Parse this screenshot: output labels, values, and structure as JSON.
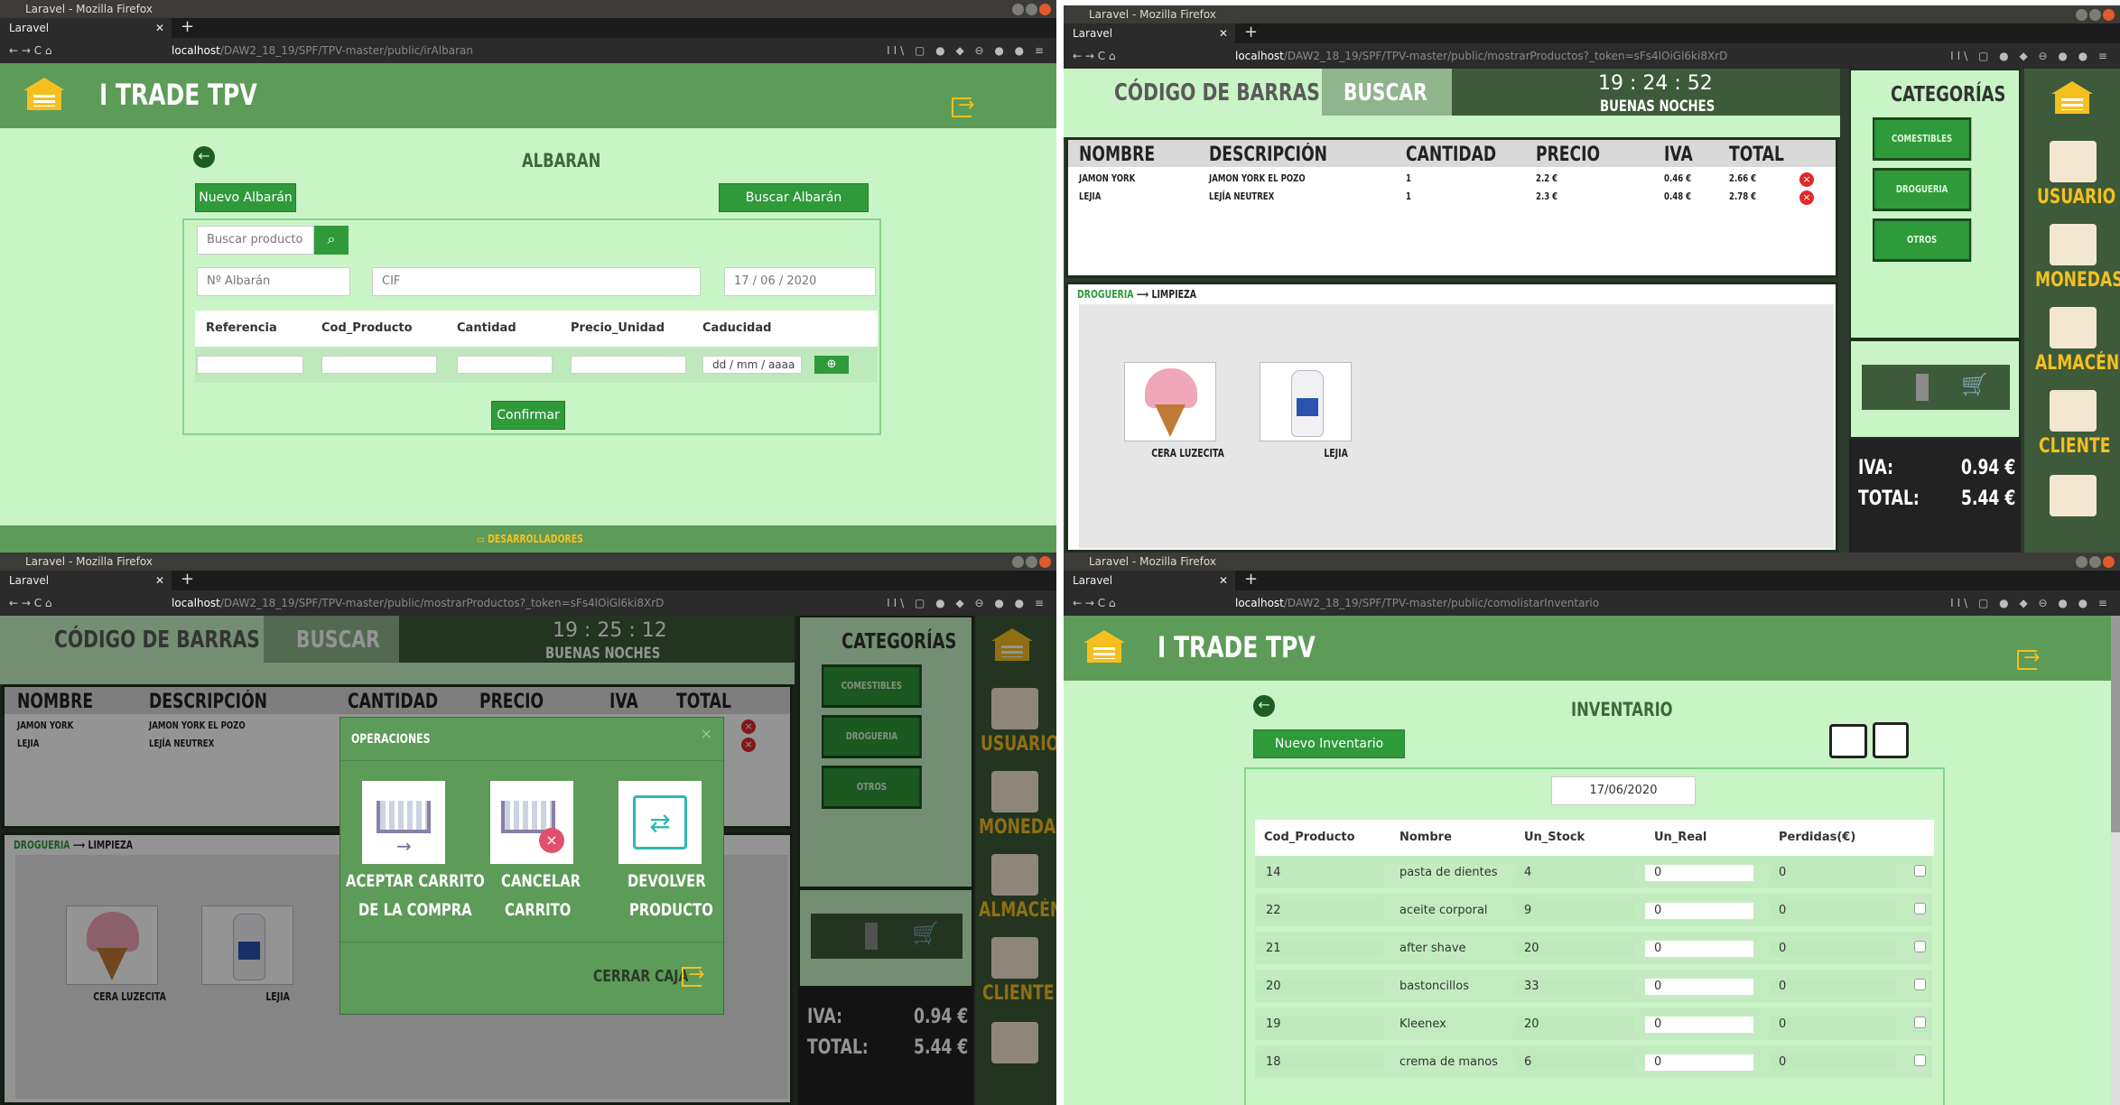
{
  "window": {
    "title": "Laravel - Mozilla Firefox",
    "tab": "Laravel",
    "close_tab": "✕",
    "new_tab": "+"
  },
  "nav_icons": "← → C ⌂",
  "right_icons": "⋯ ♡ ☆",
  "toolbar_icons": "II\\ ▢ ● ◆ ⊖ ● ● ≡",
  "urls": {
    "albaran_host": "localhost",
    "albaran_path": "/DAW2_18_19/SPF/TPV-master/public/irAlbaran",
    "productos_host": "localhost",
    "productos_path": "/DAW2_18_19/SPF/TPV-master/public/mostrarProductos?_token=sFs4lOiGl6ki8XrD",
    "productos2_path": "/DAW2_18_19/SPF/TPV-master/public/mostrarProductos?_token=sFs4lOiGl6ki8XrD",
    "inventario_host": "localhost",
    "inventario_path": "/DAW2_18_19/SPF/TPV-master/public/comolistarInventario"
  },
  "brand": "I TRADE TPV",
  "footer_link": "DESARROLLADORES",
  "albaran": {
    "title": "ALBARAN",
    "new_button": "Nuevo Albarán",
    "search_button": "Buscar Albarán",
    "search_placeholder": "Buscar producto",
    "num_placeholder": "Nº Albarán",
    "cif_placeholder": "CIF",
    "date": "17 / 06 / 2020",
    "columns": [
      "Referencia",
      "Cod_Producto",
      "Cantidad",
      "Precio_Unidad",
      "Caducidad"
    ],
    "date_placeholder": "dd / mm / aaaa",
    "confirm_button": "Confirmar"
  },
  "tpv": {
    "barcode_tab": "CÓDIGO DE BARRAS",
    "search_tab": "BUSCAR",
    "time": "19 : 24 : 52",
    "time2": "19 : 25 : 12",
    "greeting": "BUENAS NOCHES",
    "columns": [
      "NOMBRE",
      "DESCRIPCIÓN",
      "CANTIDAD",
      "PRECIO",
      "IVA",
      "TOTAL"
    ],
    "rows": [
      {
        "nombre": "JAMON YORK",
        "descripcion": "JAMON YORK EL POZO",
        "cantidad": "1",
        "precio": "2.2 €",
        "iva": "0.46 €",
        "total": "2.66 €"
      },
      {
        "nombre": "LEJIA",
        "descripcion": "LEJÍA NEUTREX",
        "cantidad": "1",
        "precio": "2.3 €",
        "iva": "0.48 €",
        "total": "2.78 €"
      }
    ],
    "breadcrumb_a": "DROGUERIA",
    "breadcrumb_b": "LIMPIEZA",
    "products": [
      "CERA LUZECITA",
      "LEJIA"
    ],
    "categories_title": "CATEGORÍAS",
    "categories": [
      "COMESTIBLES",
      "DROGUERIA",
      "OTROS"
    ],
    "iva_label": "IVA:",
    "iva_value": "0.94 €",
    "total_label": "TOTAL:",
    "total_value": "5.44 €",
    "sidebar": [
      "USUARIO",
      "MONEDAS",
      "ALMACÉN",
      "CLIENTE"
    ]
  },
  "modal": {
    "title": "OPERACIONES",
    "close": "×",
    "ops": [
      {
        "l1": "ACEPTAR CARRITO",
        "l2": "DE LA COMPRA"
      },
      {
        "l1": "CANCELAR",
        "l2": "CARRITO"
      },
      {
        "l1": "DEVOLVER",
        "l2": "PRODUCTO"
      }
    ],
    "close_cash": "CERRAR CAJA"
  },
  "inventario": {
    "title": "INVENTARIO",
    "new_button": "Nuevo Inventario",
    "date": "17/06/2020",
    "columns": [
      "Cod_Producto",
      "Nombre",
      "Un_Stock",
      "Un_Real",
      "Perdidas(€)"
    ],
    "rows": [
      {
        "cod": "14",
        "nombre": "pasta de dientes",
        "stock": "4",
        "real": "0",
        "perdidas": "0"
      },
      {
        "cod": "22",
        "nombre": "aceite corporal",
        "stock": "9",
        "real": "0",
        "perdidas": "0"
      },
      {
        "cod": "21",
        "nombre": "after shave",
        "stock": "20",
        "real": "0",
        "perdidas": "0"
      },
      {
        "cod": "20",
        "nombre": "bastoncillos",
        "stock": "33",
        "real": "0",
        "perdidas": "0"
      },
      {
        "cod": "19",
        "nombre": "Kleenex",
        "stock": "20",
        "real": "0",
        "perdidas": "0"
      },
      {
        "cod": "18",
        "nombre": "crema de manos",
        "stock": "6",
        "real": "0",
        "perdidas": "0"
      }
    ]
  }
}
